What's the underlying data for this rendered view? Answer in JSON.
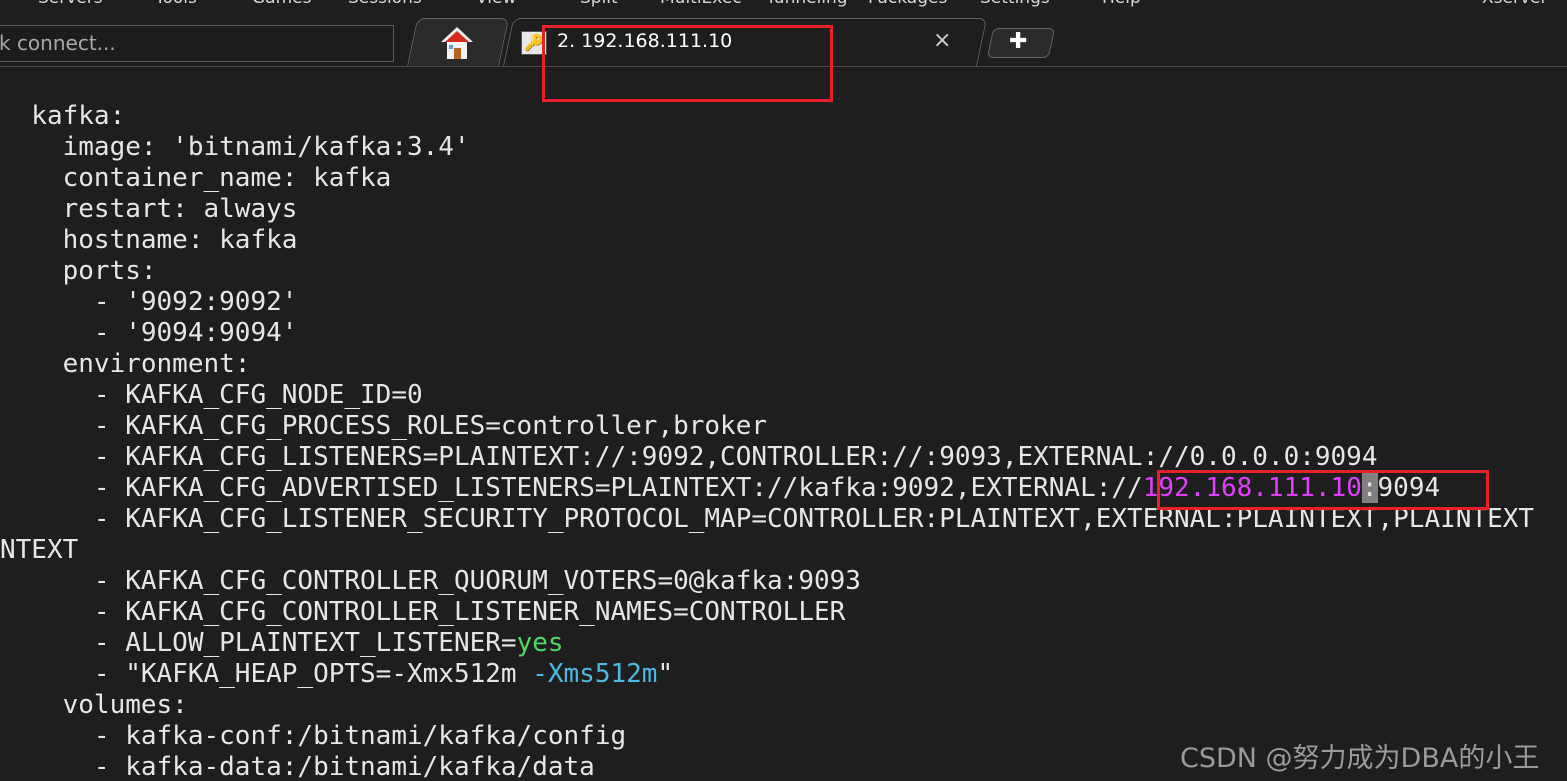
{
  "menubar": {
    "items": [
      "Servers",
      "Tools",
      "Games",
      "Sessions",
      "View",
      "Split",
      "MultiExec",
      "Tunneling",
      "Packages",
      "Settings",
      "Help"
    ],
    "right_label": "Xserver"
  },
  "quick_connect": {
    "value": "k connect..."
  },
  "tabs": {
    "home_icon": "home-icon",
    "session_icon": "key-icon",
    "session_title": "2. 192.168.111.10",
    "close_glyph": "×",
    "plus_glyph": "✚"
  },
  "terminal": {
    "lines": {
      "l1": "  kafka:",
      "l2": "    image: 'bitnami/kafka:3.4'",
      "l3": "    container_name: kafka",
      "l4": "    restart: always",
      "l5": "    hostname: kafka",
      "l6": "    ports:",
      "l7": "      - '9092:9092'",
      "l8": "      - '9094:9094'",
      "l9": "    environment:",
      "l10": "      - KAFKA_CFG_NODE_ID=0",
      "l11": "      - KAFKA_CFG_PROCESS_ROLES=controller,broker",
      "l12": "      - KAFKA_CFG_LISTENERS=PLAINTEXT://:9092,CONTROLLER://:9093,EXTERNAL://0.0.0.0:9094",
      "l13_a": "      - KAFKA_CFG_ADVERTISED_LISTENERS=PLAINTEXT://kafka:9092,EXTERNAL://",
      "l13_ip": "192.168.111.10",
      "l13_colon": ":",
      "l13_port": "9094",
      "l14": "      - KAFKA_CFG_LISTENER_SECURITY_PROTOCOL_MAP=CONTROLLER:PLAINTEXT,EXTERNAL:PLAINTEXT,PLAINTEXT",
      "l15": "NTEXT",
      "l16": "      - KAFKA_CFG_CONTROLLER_QUORUM_VOTERS=0@kafka:9093",
      "l17": "      - KAFKA_CFG_CONTROLLER_LISTENER_NAMES=CONTROLLER",
      "l18_a": "      - ALLOW_PLAINTEXT_LISTENER=",
      "l18_b": "yes",
      "l19_a": "      - \"KAFKA_HEAP_OPTS=-Xmx512m ",
      "l19_b": "-Xms512m",
      "l19_c": "\"",
      "l20": "    volumes:",
      "l21": "      - kafka-conf:/bitnami/kafka/config",
      "l22": "      - kafka-data:/bitnami/kafka/data"
    }
  },
  "watermark": "CSDN @努力成为DBA的小王",
  "colors": {
    "terminal_bg": "#1e1e1e",
    "highlight_box": "#e8202a",
    "ip_color": "#e040fb",
    "yes_color": "#4cd964",
    "flag_color": "#4fb8e0"
  }
}
